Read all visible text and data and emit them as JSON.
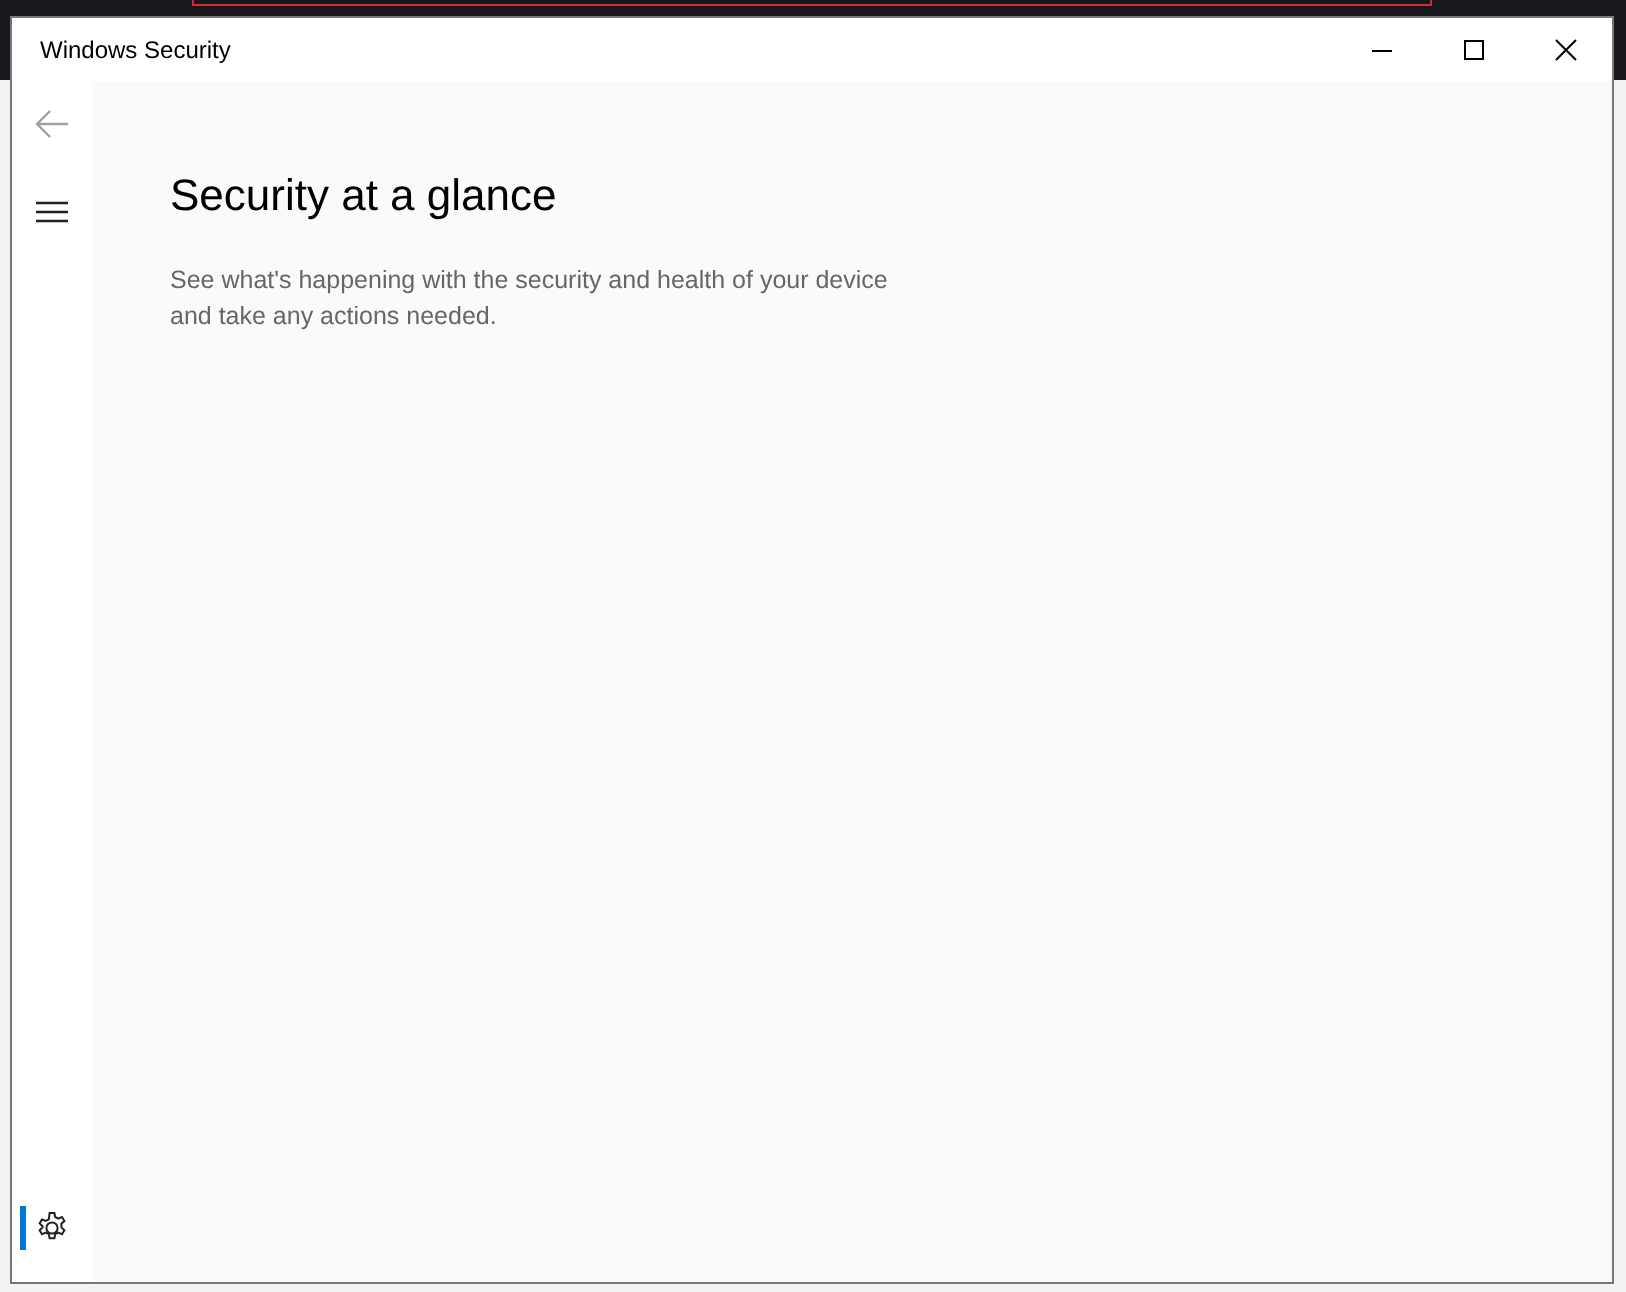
{
  "window": {
    "title": "Windows Security"
  },
  "nav": [
    {
      "kind": "back",
      "disabled": true,
      "selected": false
    },
    {
      "kind": "menu",
      "disabled": false,
      "selected": false
    },
    {
      "kind": "settings",
      "disabled": false,
      "selected": true
    }
  ],
  "page": {
    "heading": "Security at a glance",
    "description": "See what's happening with the security and health of your device and take any actions needed."
  }
}
